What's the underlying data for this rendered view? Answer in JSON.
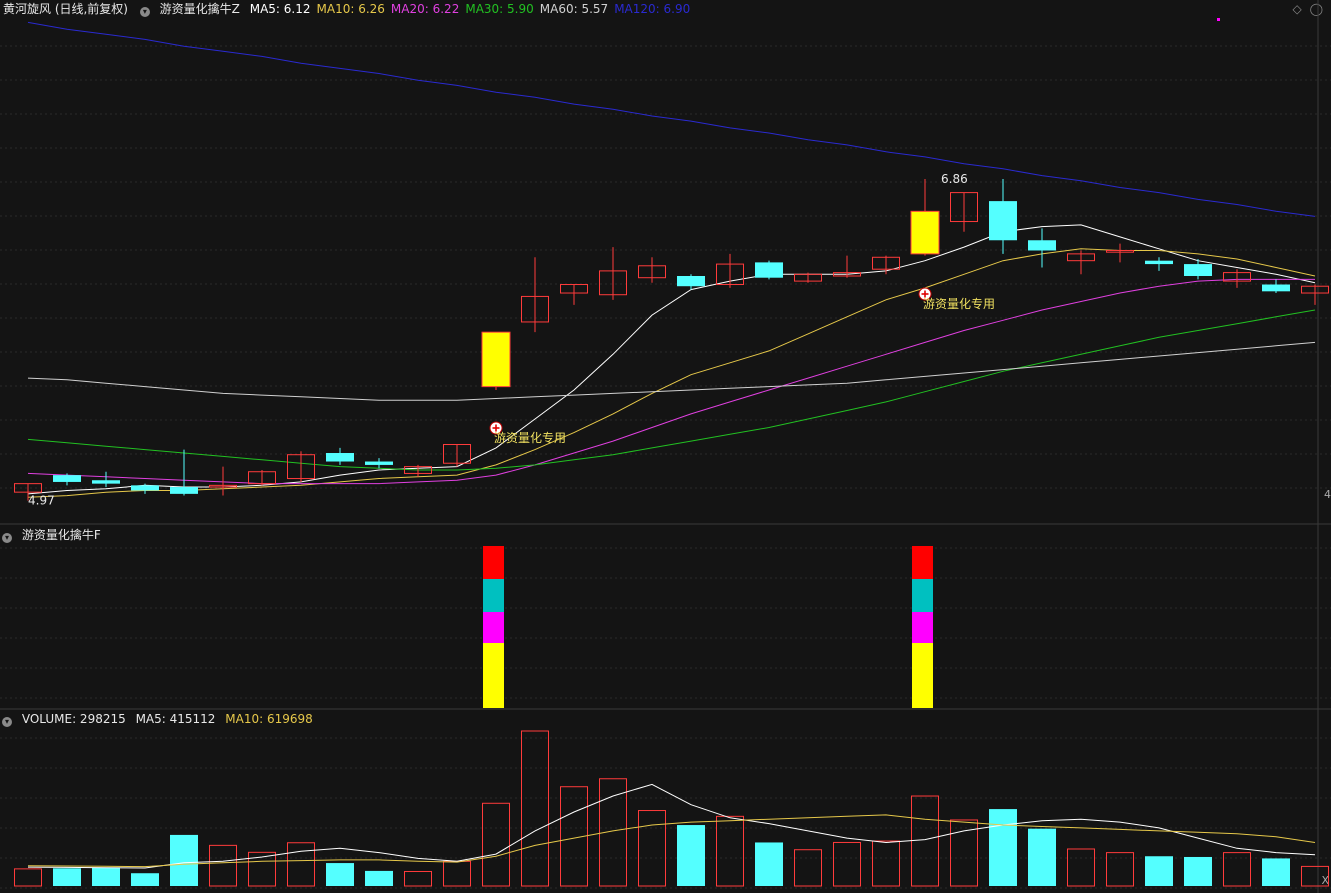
{
  "main": {
    "title": "黄河旋风 (日线,前复权)",
    "indicator_name": "游资量化擒牛Z",
    "ma": [
      {
        "label": "MA5: 6.12",
        "color": "#ffffff"
      },
      {
        "label": "MA10: 6.26",
        "color": "#e6c84a"
      },
      {
        "label": "MA20: 6.22",
        "color": "#e040e0"
      },
      {
        "label": "MA30: 5.90",
        "color": "#22c022"
      },
      {
        "label": "MA60: 5.57",
        "color": "#d0d0d0"
      },
      {
        "label": "MA120: 6.90",
        "color": "#2a2ad0"
      }
    ],
    "high_label": "6.86",
    "low_label": "4.97",
    "marker_label_1": "游资量化专用",
    "marker_label_2": "游资量化专用",
    "right_edge_label": "4"
  },
  "sub": {
    "title": "游资量化擒牛F"
  },
  "volume": {
    "label_vol": "VOLUME: 298215",
    "label_ma5": "MA5: 415112",
    "label_ma10": "MA10: 619698",
    "close_label": "X"
  },
  "colors": {
    "up": "#ff3b3b",
    "down": "#54ffff",
    "signal_yellow": "#ffff00",
    "signal_red": "#ff0000",
    "signal_cyan": "#00c0c0",
    "signal_magenta": "#ff00ff"
  },
  "chart_data": {
    "type": "candlestick",
    "candles": [
      {
        "o": 5.02,
        "c": 5.07,
        "h": 5.07,
        "l": 4.97,
        "up": true
      },
      {
        "o": 5.12,
        "c": 5.08,
        "h": 5.13,
        "l": 5.06,
        "up": false
      },
      {
        "o": 5.09,
        "c": 5.07,
        "h": 5.14,
        "l": 5.05,
        "up": false
      },
      {
        "o": 5.06,
        "c": 5.03,
        "h": 5.07,
        "l": 5.01,
        "up": false
      },
      {
        "o": 5.05,
        "c": 5.01,
        "h": 5.27,
        "l": 5.0,
        "up": false
      },
      {
        "o": 5.05,
        "c": 5.06,
        "h": 5.17,
        "l": 5.0,
        "up": true
      },
      {
        "o": 5.07,
        "c": 5.14,
        "h": 5.15,
        "l": 5.06,
        "up": true
      },
      {
        "o": 5.1,
        "c": 5.24,
        "h": 5.26,
        "l": 5.08,
        "up": true
      },
      {
        "o": 5.25,
        "c": 5.2,
        "h": 5.28,
        "l": 5.18,
        "up": false
      },
      {
        "o": 5.2,
        "c": 5.18,
        "h": 5.22,
        "l": 5.16,
        "up": false
      },
      {
        "o": 5.13,
        "c": 5.17,
        "h": 5.18,
        "l": 5.11,
        "up": true
      },
      {
        "o": 5.19,
        "c": 5.3,
        "h": 5.3,
        "l": 5.17,
        "up": true
      },
      {
        "o": 5.64,
        "c": 5.96,
        "h": 5.96,
        "l": 5.62,
        "up": true,
        "signal": true
      },
      {
        "o": 6.02,
        "c": 6.17,
        "h": 6.4,
        "l": 5.96,
        "up": true
      },
      {
        "o": 6.19,
        "c": 6.24,
        "h": 6.24,
        "l": 6.12,
        "up": true
      },
      {
        "o": 6.18,
        "c": 6.32,
        "h": 6.46,
        "l": 6.15,
        "up": true
      },
      {
        "o": 6.28,
        "c": 6.35,
        "h": 6.4,
        "l": 6.25,
        "up": true
      },
      {
        "o": 6.29,
        "c": 6.23,
        "h": 6.3,
        "l": 6.21,
        "up": false
      },
      {
        "o": 6.24,
        "c": 6.36,
        "h": 6.42,
        "l": 6.22,
        "up": true
      },
      {
        "o": 6.37,
        "c": 6.28,
        "h": 6.38,
        "l": 6.27,
        "up": false
      },
      {
        "o": 6.26,
        "c": 6.3,
        "h": 6.31,
        "l": 6.25,
        "up": true
      },
      {
        "o": 6.29,
        "c": 6.31,
        "h": 6.41,
        "l": 6.28,
        "up": true
      },
      {
        "o": 6.33,
        "c": 6.4,
        "h": 6.41,
        "l": 6.3,
        "up": true
      },
      {
        "o": 6.42,
        "c": 6.67,
        "h": 6.86,
        "l": 6.41,
        "up": true,
        "signal": true
      },
      {
        "o": 6.61,
        "c": 6.78,
        "h": 6.78,
        "l": 6.55,
        "up": true
      },
      {
        "o": 6.73,
        "c": 6.5,
        "h": 6.86,
        "l": 6.42,
        "up": false
      },
      {
        "o": 6.5,
        "c": 6.44,
        "h": 6.57,
        "l": 6.34,
        "up": false
      },
      {
        "o": 6.38,
        "c": 6.42,
        "h": 6.44,
        "l": 6.3,
        "up": true
      },
      {
        "o": 6.43,
        "c": 6.44,
        "h": 6.48,
        "l": 6.37,
        "up": true
      },
      {
        "o": 6.38,
        "c": 6.36,
        "h": 6.4,
        "l": 6.32,
        "up": false
      },
      {
        "o": 6.36,
        "c": 6.29,
        "h": 6.39,
        "l": 6.27,
        "up": false
      },
      {
        "o": 6.26,
        "c": 6.31,
        "h": 6.33,
        "l": 6.22,
        "up": true
      },
      {
        "o": 6.24,
        "c": 6.2,
        "h": 6.27,
        "l": 6.19,
        "up": false
      },
      {
        "o": 6.19,
        "c": 6.23,
        "h": 6.24,
        "l": 6.12,
        "up": true
      }
    ],
    "ma_lines": {
      "MA5": [
        5.01,
        5.03,
        5.04,
        5.06,
        5.05,
        5.05,
        5.06,
        5.08,
        5.12,
        5.15,
        5.16,
        5.17,
        5.28,
        5.45,
        5.62,
        5.83,
        6.06,
        6.21,
        6.26,
        6.3,
        6.3,
        6.3,
        6.32,
        6.38,
        6.46,
        6.55,
        6.58,
        6.59,
        6.52,
        6.45,
        6.38,
        6.34,
        6.3,
        6.25
      ],
      "MA10": [
        4.99,
        5.0,
        5.02,
        5.03,
        5.03,
        5.04,
        5.05,
        5.06,
        5.08,
        5.1,
        5.11,
        5.12,
        5.18,
        5.27,
        5.37,
        5.48,
        5.6,
        5.71,
        5.78,
        5.85,
        5.95,
        6.05,
        6.15,
        6.22,
        6.3,
        6.38,
        6.42,
        6.45,
        6.44,
        6.44,
        6.42,
        6.39,
        6.34,
        6.29
      ],
      "MA20": [
        5.13,
        5.12,
        5.11,
        5.1,
        5.09,
        5.08,
        5.07,
        5.07,
        5.07,
        5.07,
        5.08,
        5.09,
        5.12,
        5.18,
        5.25,
        5.32,
        5.4,
        5.48,
        5.55,
        5.62,
        5.69,
        5.76,
        5.83,
        5.9,
        5.97,
        6.03,
        6.09,
        6.14,
        6.19,
        6.23,
        6.26,
        6.27,
        6.27,
        6.27
      ],
      "MA30": [
        5.33,
        5.31,
        5.29,
        5.27,
        5.25,
        5.23,
        5.21,
        5.19,
        5.17,
        5.16,
        5.15,
        5.15,
        5.16,
        5.18,
        5.21,
        5.24,
        5.28,
        5.32,
        5.36,
        5.4,
        5.45,
        5.5,
        5.55,
        5.61,
        5.67,
        5.73,
        5.78,
        5.83,
        5.88,
        5.93,
        5.97,
        6.01,
        6.05,
        6.09
      ],
      "MA60": [
        5.69,
        5.68,
        5.66,
        5.64,
        5.62,
        5.6,
        5.59,
        5.58,
        5.57,
        5.56,
        5.56,
        5.56,
        5.57,
        5.58,
        5.59,
        5.6,
        5.61,
        5.62,
        5.63,
        5.64,
        5.65,
        5.66,
        5.68,
        5.7,
        5.72,
        5.74,
        5.76,
        5.78,
        5.8,
        5.82,
        5.84,
        5.86,
        5.88,
        5.9
      ],
      "MA120": [
        7.78,
        7.74,
        7.71,
        7.68,
        7.64,
        7.61,
        7.58,
        7.54,
        7.51,
        7.48,
        7.44,
        7.41,
        7.37,
        7.34,
        7.3,
        7.27,
        7.23,
        7.2,
        7.16,
        7.13,
        7.09,
        7.06,
        7.02,
        6.99,
        6.95,
        6.92,
        6.88,
        6.85,
        6.81,
        6.78,
        6.74,
        6.71,
        6.67,
        6.64
      ]
    },
    "volume": [
      {
        "v": 118000,
        "up": true
      },
      {
        "v": 122000,
        "up": false
      },
      {
        "v": 128000,
        "up": false
      },
      {
        "v": 88000,
        "up": false
      },
      {
        "v": 352000,
        "up": false
      },
      {
        "v": 280000,
        "up": true
      },
      {
        "v": 232000,
        "up": true
      },
      {
        "v": 298000,
        "up": true
      },
      {
        "v": 158000,
        "up": false
      },
      {
        "v": 104000,
        "up": false
      },
      {
        "v": 100000,
        "up": true
      },
      {
        "v": 170000,
        "up": true
      },
      {
        "v": 570000,
        "up": true
      },
      {
        "v": 1068000,
        "up": true
      },
      {
        "v": 684000,
        "up": true
      },
      {
        "v": 739000,
        "up": true
      },
      {
        "v": 520000,
        "up": true
      },
      {
        "v": 420000,
        "up": false
      },
      {
        "v": 480000,
        "up": true
      },
      {
        "v": 300000,
        "up": false
      },
      {
        "v": 250000,
        "up": true
      },
      {
        "v": 300000,
        "up": true
      },
      {
        "v": 310000,
        "up": true
      },
      {
        "v": 620000,
        "up": true
      },
      {
        "v": 455000,
        "up": true
      },
      {
        "v": 530000,
        "up": false
      },
      {
        "v": 395000,
        "up": false
      },
      {
        "v": 255000,
        "up": true
      },
      {
        "v": 230000,
        "up": true
      },
      {
        "v": 205000,
        "up": false
      },
      {
        "v": 200000,
        "up": false
      },
      {
        "v": 230000,
        "up": true
      },
      {
        "v": 190000,
        "up": false
      },
      {
        "v": 135000,
        "up": true
      }
    ],
    "vol_ma5": [
      130000,
      128000,
      126000,
      124000,
      160000,
      170000,
      200000,
      240000,
      260000,
      230000,
      190000,
      170000,
      220000,
      380000,
      510000,
      620000,
      700000,
      560000,
      470000,
      430000,
      380000,
      330000,
      300000,
      320000,
      380000,
      420000,
      450000,
      460000,
      440000,
      400000,
      330000,
      260000,
      230000,
      215000
    ],
    "vol_ma10": [
      140000,
      138000,
      136000,
      134000,
      150000,
      160000,
      170000,
      175000,
      180000,
      180000,
      170000,
      165000,
      205000,
      280000,
      330000,
      380000,
      420000,
      440000,
      450000,
      460000,
      470000,
      480000,
      490000,
      460000,
      440000,
      420000,
      410000,
      400000,
      390000,
      380000,
      370000,
      360000,
      340000,
      300000
    ],
    "signals": [
      12,
      23
    ]
  }
}
